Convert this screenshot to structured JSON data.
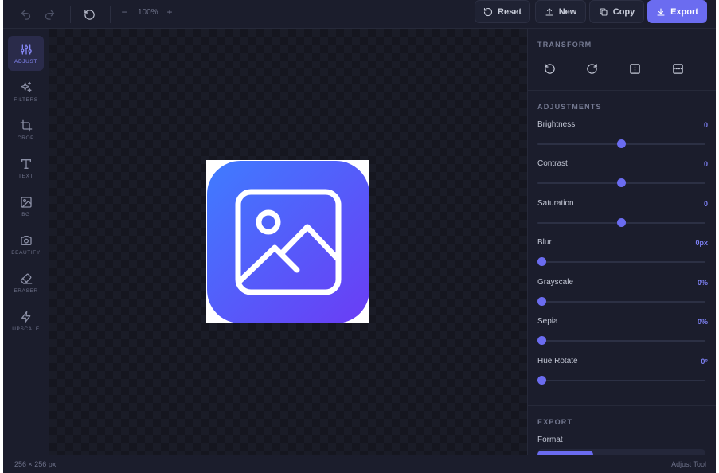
{
  "toolbar": {
    "zoom": "100%",
    "zoom_out": "−",
    "zoom_in": "+",
    "reset_label": "Reset",
    "new_label": "New",
    "copy_label": "Copy",
    "export_label": "Export",
    "accent_color": "#6b6cf0"
  },
  "sidebar": {
    "items": [
      {
        "label": "ADJUST",
        "icon": "sliders-icon",
        "active": true
      },
      {
        "label": "FILTERS",
        "icon": "sparkles-icon",
        "active": false
      },
      {
        "label": "CROP",
        "icon": "crop-icon",
        "active": false
      },
      {
        "label": "TEXT",
        "icon": "type-icon",
        "active": false
      },
      {
        "label": "BG",
        "icon": "image-icon",
        "active": false
      },
      {
        "label": "BEAUTIFY",
        "icon": "camera-icon",
        "active": false
      },
      {
        "label": "ERASER",
        "icon": "eraser-icon",
        "active": false
      },
      {
        "label": "UPSCALE",
        "icon": "lightning-icon",
        "active": false
      }
    ]
  },
  "canvas": {
    "preview_icon": "image-placeholder-icon",
    "gradient": [
      "#3f7cff",
      "#6b3cf5"
    ]
  },
  "panel": {
    "transform_title": "TRANSFORM",
    "transform_icons": [
      "rotate-left-icon",
      "rotate-right-icon",
      "flip-horizontal-icon",
      "flip-vertical-icon"
    ],
    "adjustments_title": "ADJUSTMENTS",
    "adjustments": [
      {
        "label": "Brightness",
        "value": "0",
        "fraction": 0.5
      },
      {
        "label": "Contrast",
        "value": "0",
        "fraction": 0.5
      },
      {
        "label": "Saturation",
        "value": "0",
        "fraction": 0.5
      },
      {
        "label": "Blur",
        "value": "0px",
        "fraction": 0.0
      },
      {
        "label": "Grayscale",
        "value": "0%",
        "fraction": 0.0
      },
      {
        "label": "Sepia",
        "value": "0%",
        "fraction": 0.0
      },
      {
        "label": "Hue Rotate",
        "value": "0°",
        "fraction": 0.0
      }
    ],
    "export_title": "EXPORT",
    "format_label": "Format"
  },
  "status": {
    "dimensions": "256 × 256 px",
    "tool": "Adjust Tool"
  }
}
